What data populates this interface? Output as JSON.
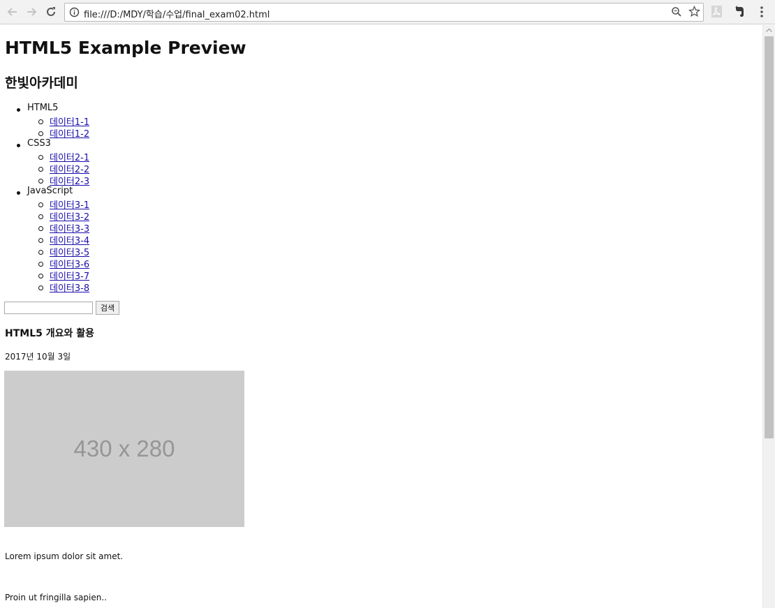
{
  "browser": {
    "url": "file:///D:/MDY/학습/수업/final_exam02.html",
    "icons": [
      "back-arrow-icon",
      "forward-arrow-icon",
      "reload-icon",
      "info-icon",
      "zoom-icon",
      "star-icon",
      "pdf-extension-icon",
      "evernote-extension-icon",
      "menu-dots-icon"
    ]
  },
  "page": {
    "title": "HTML5 Example Preview",
    "subtitle": "한빛아카데미",
    "nav": [
      {
        "label": "HTML5",
        "items": [
          "데이터1-1",
          "데이터1-2"
        ]
      },
      {
        "label": "CSS3",
        "items": [
          "데이터2-1",
          "데이터2-2",
          "데이터2-3"
        ]
      },
      {
        "label": "JavaScript",
        "items": [
          "데이터3-1",
          "데이터3-2",
          "데이터3-3",
          "데이터3-4",
          "데이터3-5",
          "데이터3-6",
          "데이터3-7",
          "데이터3-8"
        ]
      }
    ],
    "search": {
      "value": "",
      "button_label": "검색"
    },
    "article": {
      "title": "HTML5 개요와 활용",
      "date": "2017년 10월 3일",
      "image_label": "430 x 280",
      "paragraphs": [
        "Lorem ipsum dolor sit amet.",
        "Proin ut fringilla sapien.."
      ]
    }
  },
  "colors": {
    "link": "#1a0dab",
    "placeholder_bg": "#cccccc",
    "placeholder_text": "#969696"
  }
}
